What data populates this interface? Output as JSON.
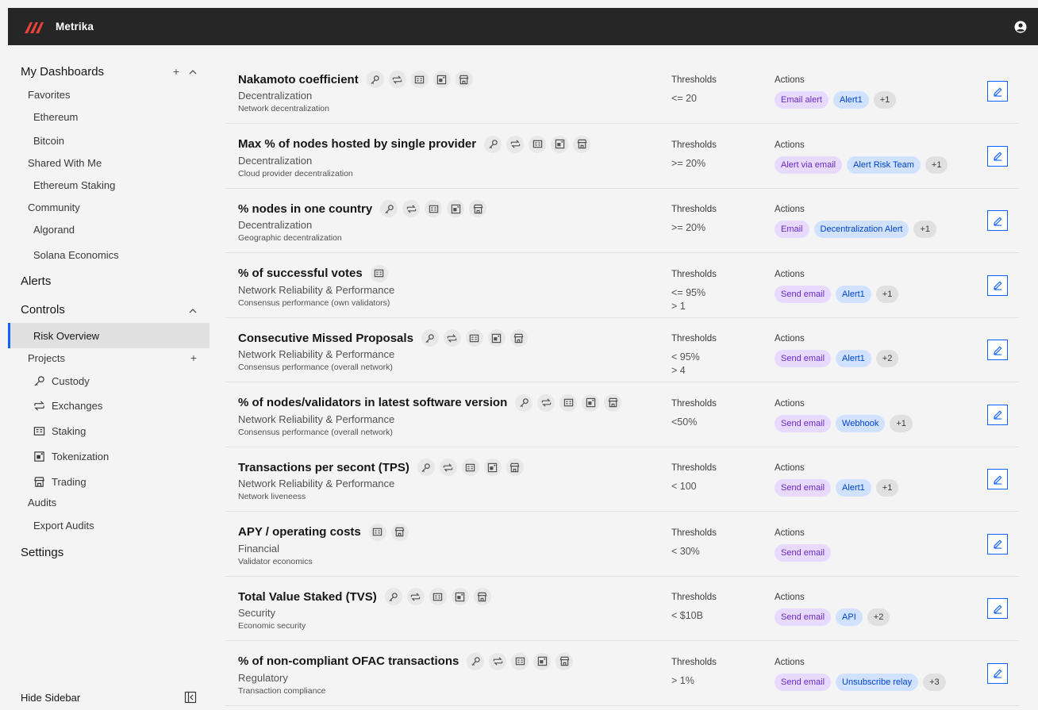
{
  "app": {
    "brand": "Metrika"
  },
  "colors": {
    "topbar": "#262626",
    "accent": "#0f62fe",
    "tag_purple": "#e8daff",
    "tag_blue": "#d0e2ff",
    "tag_gray": "#e0e0e0"
  },
  "sidebar": {
    "my_dashboards": "My Dashboards",
    "favorites": "Favorites",
    "ethereum": "Ethereum",
    "bitcoin": "Bitcoin",
    "shared": "Shared With Me",
    "ethereum_staking": "Ethereum Staking",
    "community": "Community",
    "algorand": "Algorand",
    "solana": "Solana Economics",
    "alerts": "Alerts",
    "controls": "Controls",
    "risk_overview": "Risk Overview",
    "projects": "Projects",
    "custody": "Custody",
    "exchanges": "Exchanges",
    "staking": "Staking",
    "tokenization": "Tokenization",
    "trading": "Trading",
    "audits": "Audits",
    "export_audits": "Export Audits",
    "settings": "Settings",
    "hide_sidebar": "Hide Sidebar",
    "icons": {
      "plus": "+",
      "chevron_up": "^"
    }
  },
  "rows": [
    {
      "title": "Nakamoto coefficient",
      "icons": [
        "key-icon",
        "exchange-icon",
        "staking-icon",
        "tokenization-icon",
        "trading-icon"
      ],
      "category": "Decentralization",
      "subcategory": "Network decentralization",
      "thresholds_label": "Thresholds",
      "thresholds": [
        "<= 20"
      ],
      "actions_label": "Actions",
      "actions": [
        {
          "label": "Email alert",
          "color": "purple"
        },
        {
          "label": "Alert1",
          "color": "blue"
        },
        {
          "label": "+1",
          "color": "gray"
        }
      ]
    },
    {
      "title": "Max % of nodes hosted by single provider",
      "icons": [
        "key-icon",
        "exchange-icon",
        "staking-icon",
        "tokenization-icon",
        "trading-icon"
      ],
      "category": "Decentralization",
      "subcategory": "Cloud provider decentralization",
      "thresholds_label": "Thresholds",
      "thresholds": [
        ">= 20%"
      ],
      "actions_label": "Actions",
      "actions": [
        {
          "label": "Alert via email",
          "color": "purple"
        },
        {
          "label": "Alert Risk Team",
          "color": "blue"
        },
        {
          "label": "+1",
          "color": "gray"
        }
      ]
    },
    {
      "title": "% nodes in one country",
      "icons": [
        "key-icon",
        "exchange-icon",
        "staking-icon",
        "tokenization-icon",
        "trading-icon"
      ],
      "category": "Decentralization",
      "subcategory": "Geographic decentralization",
      "thresholds_label": "Thresholds",
      "thresholds": [
        ">= 20%"
      ],
      "actions_label": "Actions",
      "actions": [
        {
          "label": "Email",
          "color": "purple"
        },
        {
          "label": "Decentralization Alert",
          "color": "blue"
        },
        {
          "label": "+1",
          "color": "gray"
        }
      ]
    },
    {
      "title": "% of successful votes",
      "icons": [
        "staking-icon"
      ],
      "category": "Network Reliability & Performance",
      "subcategory": "Consensus performance (own validators)",
      "thresholds_label": "Thresholds",
      "thresholds": [
        "<= 95%",
        "> 1"
      ],
      "actions_label": "Actions",
      "actions": [
        {
          "label": "Send email",
          "color": "purple"
        },
        {
          "label": "Alert1",
          "color": "blue"
        },
        {
          "label": "+1",
          "color": "gray"
        }
      ]
    },
    {
      "title": "Consecutive Missed Proposals",
      "icons": [
        "key-icon",
        "exchange-icon",
        "staking-icon",
        "tokenization-icon",
        "trading-icon"
      ],
      "category": "Network Reliability & Performance",
      "subcategory": "Consensus performance (overall network)",
      "thresholds_label": "Thresholds",
      "thresholds": [
        "< 95%",
        "> 4"
      ],
      "actions_label": "Actions",
      "actions": [
        {
          "label": "Send email",
          "color": "purple"
        },
        {
          "label": "Alert1",
          "color": "blue"
        },
        {
          "label": "+2",
          "color": "gray"
        }
      ]
    },
    {
      "title": "% of nodes/validators in latest software version",
      "icons": [
        "key-icon",
        "exchange-icon",
        "staking-icon",
        "tokenization-icon",
        "trading-icon"
      ],
      "category": "Network Reliability & Performance",
      "subcategory": "Consensus performance (overall network)",
      "thresholds_label": "Thresholds",
      "thresholds": [
        "<50%"
      ],
      "actions_label": "Actions",
      "actions": [
        {
          "label": "Send email",
          "color": "purple"
        },
        {
          "label": "Webhook",
          "color": "blue"
        },
        {
          "label": "+1",
          "color": "gray"
        }
      ]
    },
    {
      "title": "Transactions per secont (TPS)",
      "icons": [
        "key-icon",
        "exchange-icon",
        "staking-icon",
        "tokenization-icon",
        "trading-icon"
      ],
      "category": "Network Reliability & Performance",
      "subcategory": "Network liveneess",
      "thresholds_label": "Thresholds",
      "thresholds": [
        "< 100"
      ],
      "actions_label": "Actions",
      "actions": [
        {
          "label": "Send email",
          "color": "purple"
        },
        {
          "label": "Alert1",
          "color": "blue"
        },
        {
          "label": "+1",
          "color": "gray"
        }
      ]
    },
    {
      "title": "APY / operating costs",
      "icons": [
        "staking-icon",
        "trading-icon"
      ],
      "category": "Financial",
      "subcategory": "Validator economics",
      "thresholds_label": "Thresholds",
      "thresholds": [
        "< 30%"
      ],
      "actions_label": "Actions",
      "actions": [
        {
          "label": "Send email",
          "color": "purple"
        }
      ]
    },
    {
      "title": "Total Value Staked (TVS)",
      "icons": [
        "key-icon",
        "exchange-icon",
        "staking-icon",
        "tokenization-icon",
        "trading-icon"
      ],
      "category": "Security",
      "subcategory": "Economic security",
      "thresholds_label": "Thresholds",
      "thresholds": [
        "< $10B"
      ],
      "actions_label": "Actions",
      "actions": [
        {
          "label": "Send email",
          "color": "purple"
        },
        {
          "label": "API",
          "color": "blue"
        },
        {
          "label": "+2",
          "color": "gray"
        }
      ]
    },
    {
      "title": "% of non-compliant OFAC transactions",
      "icons": [
        "key-icon",
        "exchange-icon",
        "staking-icon",
        "tokenization-icon",
        "trading-icon"
      ],
      "category": "Regulatory",
      "subcategory": "Transaction compliance",
      "thresholds_label": "Thresholds",
      "thresholds": [
        "> 1%"
      ],
      "actions_label": "Actions",
      "actions": [
        {
          "label": "Send email",
          "color": "purple"
        },
        {
          "label": "Unsubscribe relay",
          "color": "blue"
        },
        {
          "label": "+3",
          "color": "gray"
        }
      ]
    }
  ]
}
